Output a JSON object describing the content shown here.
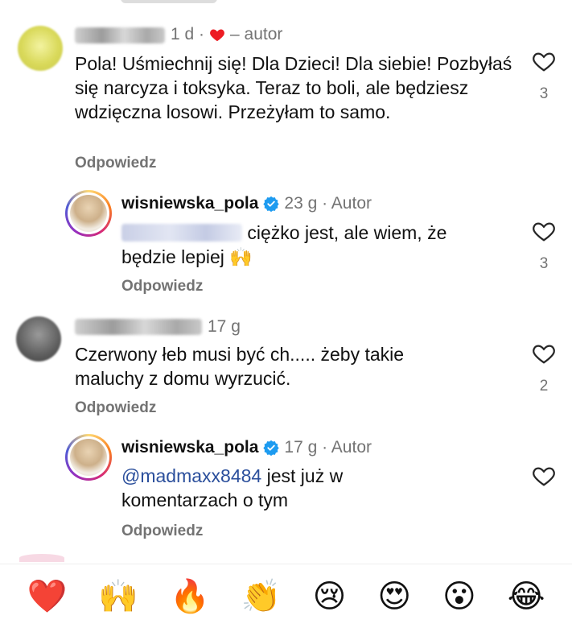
{
  "comments": [
    {
      "meta": "1 d ·",
      "author_tag": "– autor",
      "text": "Pola! Uśmiechnij się! Dla Dzieci! Dla siebie! Pozbyłaś się narcyza i toksyka. Teraz to boli, ale będziesz wdzięczna losowi. Przeżyłam to samo.",
      "reply_label": "Odpowiedz",
      "likes": "3"
    },
    {
      "username": "wisniewska_pola",
      "meta": "23 g · Autor",
      "text_after_mention": "ciężko jest, ale wiem, że będzie lepiej 🙌",
      "reply_label": "Odpowiedz",
      "likes": "3"
    },
    {
      "meta": "17 g",
      "text": "Czerwony łeb musi być ch..... żeby takie maluchy z domu wyrzucić.",
      "reply_label": "Odpowiedz",
      "likes": "2"
    },
    {
      "username": "wisniewska_pola",
      "meta": "17 g · Autor",
      "mention": "@madmaxx8484",
      "text_after_mention": " jest już w komentarzach o tym",
      "reply_label": "Odpowiedz"
    }
  ],
  "emoji_bar": [
    "❤️",
    "🙌",
    "🔥",
    "👏",
    "😢",
    "😍",
    "😮",
    "😂"
  ],
  "colors": {
    "heart": "#ed1c24",
    "verified": "#1d9bf0",
    "mention": "#2b4f9c",
    "muted": "#737373"
  }
}
